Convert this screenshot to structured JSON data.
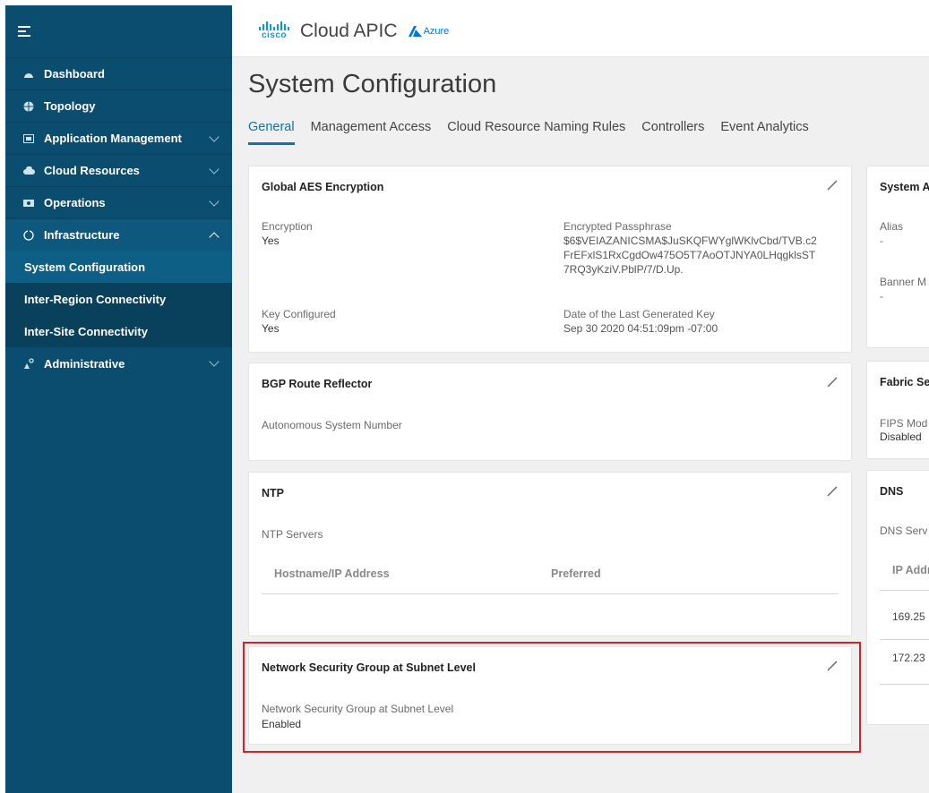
{
  "sidebar": {
    "items": [
      {
        "label": "Dashboard"
      },
      {
        "label": "Topology"
      },
      {
        "label": "Application Management"
      },
      {
        "label": "Cloud Resources"
      },
      {
        "label": "Operations"
      },
      {
        "label": "Infrastructure"
      },
      {
        "label": "Administrative"
      }
    ],
    "sub_items": [
      {
        "label": "System Configuration"
      },
      {
        "label": "Inter-Region Connectivity"
      },
      {
        "label": "Inter-Site Connectivity"
      }
    ]
  },
  "header": {
    "logo_text": "cisco",
    "app_title": "Cloud APIC",
    "cloud_provider": "Azure"
  },
  "page": {
    "title": "System Configuration",
    "tabs": [
      {
        "label": "General"
      },
      {
        "label": "Management Access"
      },
      {
        "label": "Cloud Resource Naming Rules"
      },
      {
        "label": "Controllers"
      },
      {
        "label": "Event Analytics"
      }
    ]
  },
  "cards": {
    "aes": {
      "title": "Global AES Encryption",
      "encryption_label": "Encryption",
      "encryption_value": "Yes",
      "passphrase_label": "Encrypted Passphrase",
      "passphrase_line1": "$6$VEIAZANICSMA$JuSKQFWYglWKlvCbd/TVB.c2",
      "passphrase_line2": "FrEFxlS1RxCgdOw475O5T7AoOTJNYA0LHqgklsST",
      "passphrase_line3": "7RQ3yKziV.PblP/7/D.Up.",
      "key_label": "Key Configured",
      "key_value": "Yes",
      "date_label": "Date of the Last Generated Key",
      "date_value": "Sep 30 2020 04:51:09pm -07:00"
    },
    "bgp": {
      "title": "BGP Route Reflector",
      "asn_label": "Autonomous System Number"
    },
    "ntp": {
      "title": "NTP",
      "servers_label": "NTP Servers",
      "col_host": "Hostname/IP Address",
      "col_pref": "Preferred"
    },
    "nsg": {
      "title": "Network Security Group at Subnet Level",
      "field_label": "Network Security Group at Subnet Level",
      "field_value": "Enabled"
    },
    "system_alias": {
      "title": "System A",
      "alias_label": "Alias",
      "alias_value": "-",
      "banner_label": "Banner M",
      "banner_value": "-"
    },
    "fabric": {
      "title": "Fabric Se",
      "fips_label": "FIPS Mod",
      "fips_value": "Disabled"
    },
    "dns": {
      "title": "DNS",
      "servers_label": "DNS Serv",
      "col_ip": "IP Addr",
      "rows": [
        "169.25",
        "172.23"
      ]
    }
  }
}
